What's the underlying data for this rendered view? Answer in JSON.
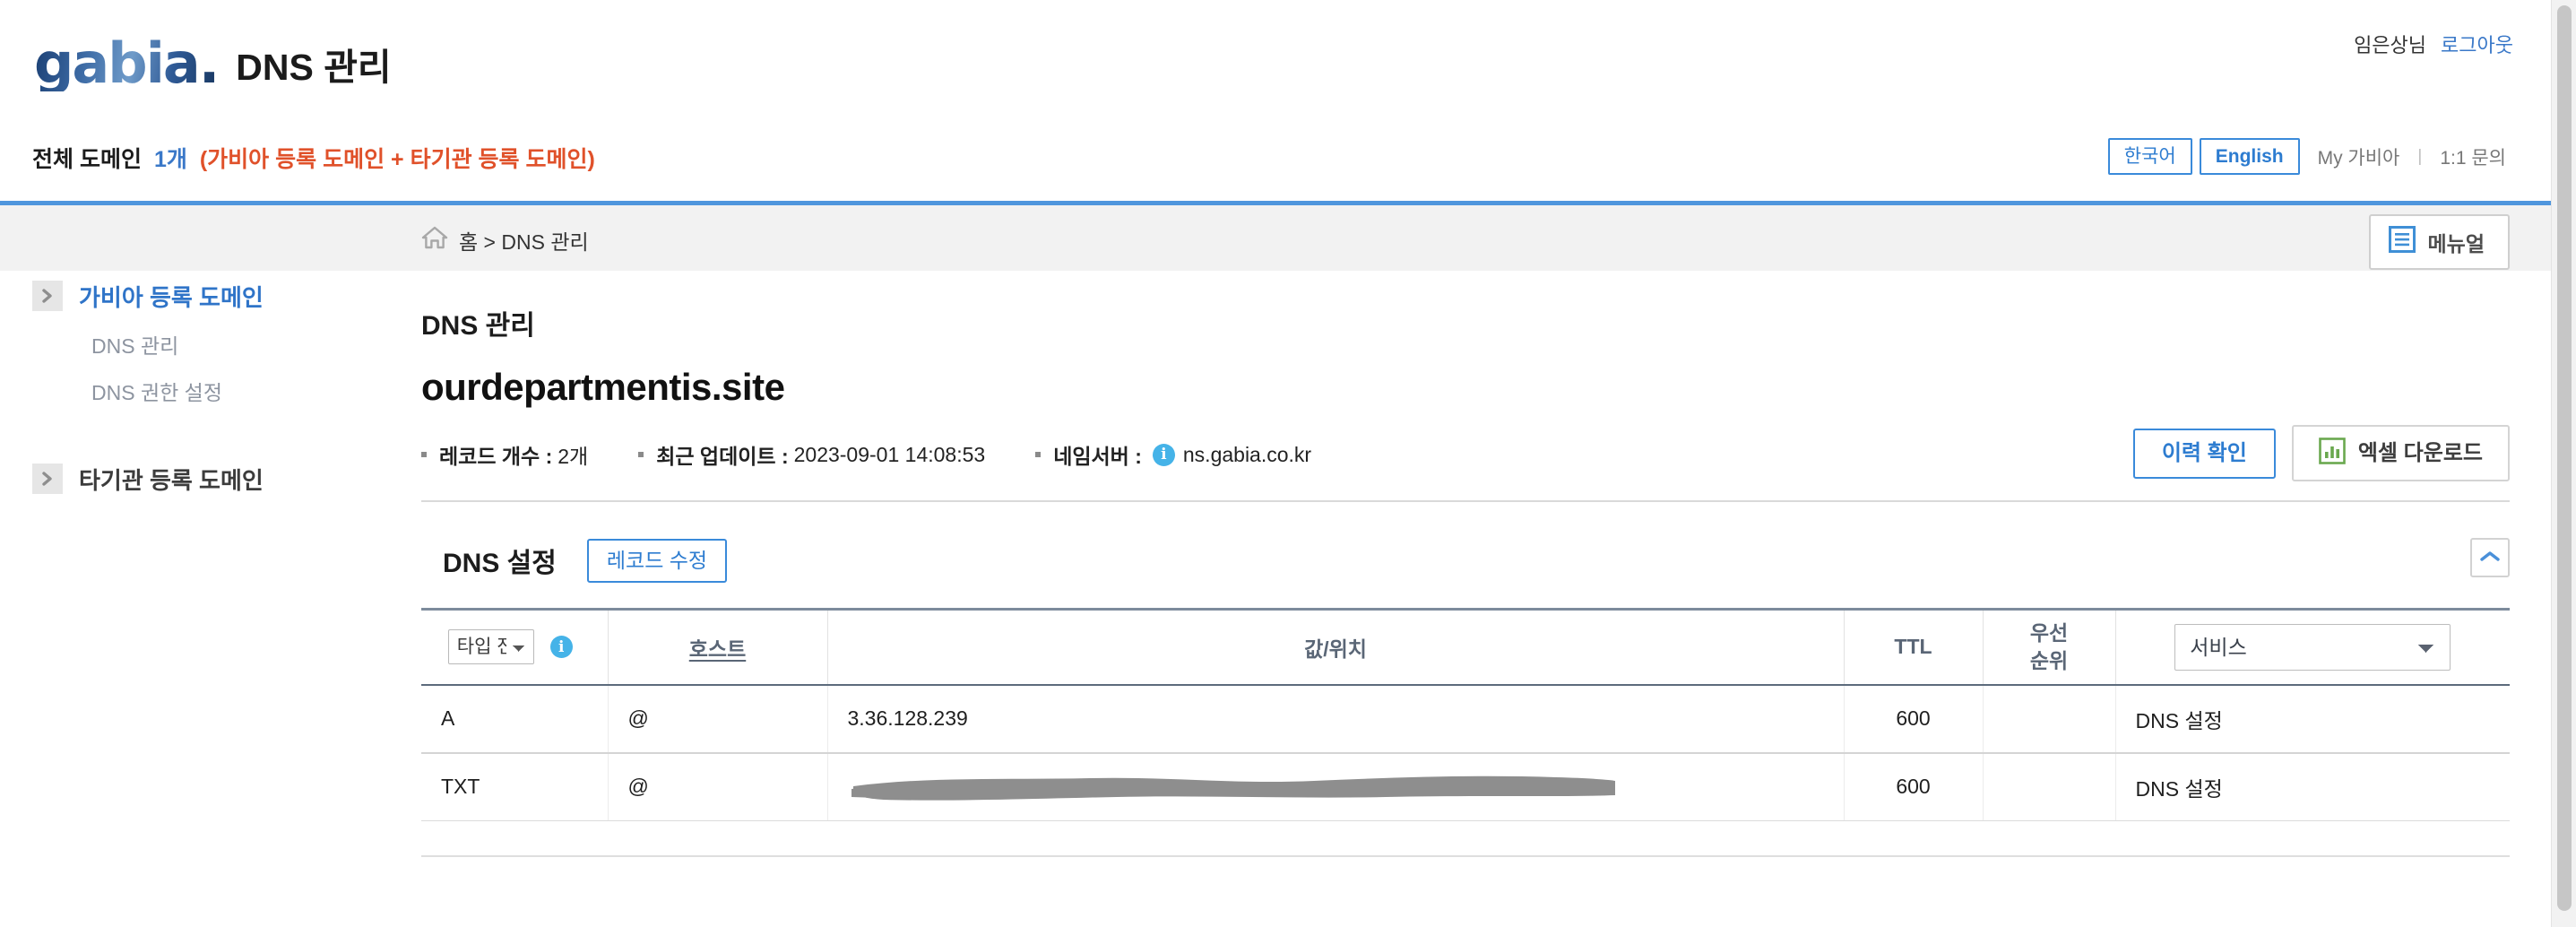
{
  "header": {
    "logo_text": "gabia.",
    "page_title": "DNS 관리",
    "user_name": "임은상님",
    "logout_label": "로그아웃"
  },
  "summary": {
    "label": "전체 도메인",
    "count": "1개",
    "note": "(가비아 등록 도메인 + 타기관 등록 도메인)",
    "lang_ko": "한국어",
    "lang_en": "English",
    "my_gabia": "My 가비아",
    "separator": "|",
    "inquiry": "1:1 문의"
  },
  "breadcrumb": {
    "text": "홈 > DNS 관리",
    "manual_label": "메뉴얼"
  },
  "sidebar": {
    "groups": [
      {
        "label": "가비아 등록 도메인",
        "active": true,
        "children": [
          "DNS 관리",
          "DNS 권한 설정"
        ]
      },
      {
        "label": "타기관 등록 도메인",
        "active": false,
        "children": []
      }
    ]
  },
  "main": {
    "title": "DNS 관리",
    "domain": "ourdepartmentis.site",
    "meta": {
      "record_count_label": "레코드 개수 :",
      "record_count_value": "2개",
      "updated_label": "최근 업데이트 :",
      "updated_value": "2023-09-01 14:08:53",
      "nameserver_label": "네임서버 :",
      "nameserver_value": "ns.gabia.co.kr"
    },
    "actions": {
      "history": "이력 확인",
      "excel": "엑셀 다운로드"
    },
    "section": {
      "title": "DNS 설정",
      "edit_record": "레코드 수정"
    }
  },
  "table": {
    "type_filter_value": "타입 전체",
    "service_filter_value": "서비스",
    "headers": {
      "type": "타입",
      "host": "호스트",
      "value": "값/위치",
      "ttl": "TTL",
      "priority_line1": "우선",
      "priority_line2": "순위",
      "service": "서비스"
    },
    "rows": [
      {
        "type": "A",
        "host": "@",
        "value": "3.36.128.239",
        "value_redacted": false,
        "ttl": "600",
        "priority": "",
        "service": "DNS 설정"
      },
      {
        "type": "TXT",
        "host": "@",
        "value": "",
        "value_redacted": true,
        "ttl": "600",
        "priority": "",
        "service": "DNS 설정"
      }
    ]
  },
  "colors": {
    "accent_blue": "#3a8ada",
    "link_blue": "#3a78c8",
    "orange": "#e0512a",
    "header_rule": "#4f96dd",
    "table_head_text": "#5a6676",
    "excel_green": "#6aa84f"
  }
}
